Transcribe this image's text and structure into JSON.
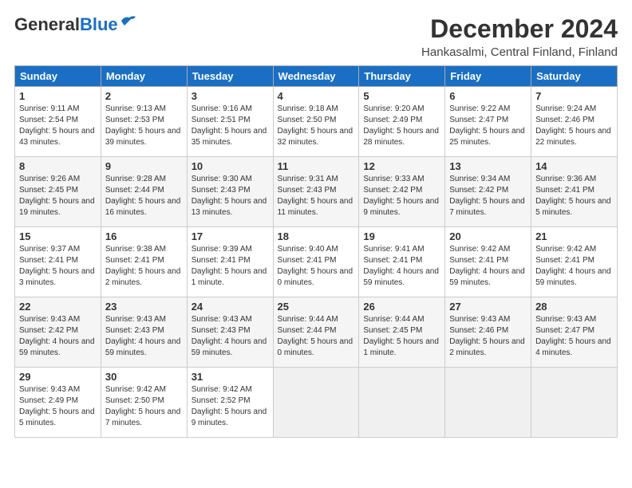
{
  "logo": {
    "line1": "General",
    "line2": "Blue"
  },
  "title": "December 2024",
  "location": "Hankasalmi, Central Finland, Finland",
  "headers": [
    "Sunday",
    "Monday",
    "Tuesday",
    "Wednesday",
    "Thursday",
    "Friday",
    "Saturday"
  ],
  "weeks": [
    [
      {
        "day": "1",
        "sunrise": "9:11 AM",
        "sunset": "2:54 PM",
        "daylight": "5 hours and 43 minutes."
      },
      {
        "day": "2",
        "sunrise": "9:13 AM",
        "sunset": "2:53 PM",
        "daylight": "5 hours and 39 minutes."
      },
      {
        "day": "3",
        "sunrise": "9:16 AM",
        "sunset": "2:51 PM",
        "daylight": "5 hours and 35 minutes."
      },
      {
        "day": "4",
        "sunrise": "9:18 AM",
        "sunset": "2:50 PM",
        "daylight": "5 hours and 32 minutes."
      },
      {
        "day": "5",
        "sunrise": "9:20 AM",
        "sunset": "2:49 PM",
        "daylight": "5 hours and 28 minutes."
      },
      {
        "day": "6",
        "sunrise": "9:22 AM",
        "sunset": "2:47 PM",
        "daylight": "5 hours and 25 minutes."
      },
      {
        "day": "7",
        "sunrise": "9:24 AM",
        "sunset": "2:46 PM",
        "daylight": "5 hours and 22 minutes."
      }
    ],
    [
      {
        "day": "8",
        "sunrise": "9:26 AM",
        "sunset": "2:45 PM",
        "daylight": "5 hours and 19 minutes."
      },
      {
        "day": "9",
        "sunrise": "9:28 AM",
        "sunset": "2:44 PM",
        "daylight": "5 hours and 16 minutes."
      },
      {
        "day": "10",
        "sunrise": "9:30 AM",
        "sunset": "2:43 PM",
        "daylight": "5 hours and 13 minutes."
      },
      {
        "day": "11",
        "sunrise": "9:31 AM",
        "sunset": "2:43 PM",
        "daylight": "5 hours and 11 minutes."
      },
      {
        "day": "12",
        "sunrise": "9:33 AM",
        "sunset": "2:42 PM",
        "daylight": "5 hours and 9 minutes."
      },
      {
        "day": "13",
        "sunrise": "9:34 AM",
        "sunset": "2:42 PM",
        "daylight": "5 hours and 7 minutes."
      },
      {
        "day": "14",
        "sunrise": "9:36 AM",
        "sunset": "2:41 PM",
        "daylight": "5 hours and 5 minutes."
      }
    ],
    [
      {
        "day": "15",
        "sunrise": "9:37 AM",
        "sunset": "2:41 PM",
        "daylight": "5 hours and 3 minutes."
      },
      {
        "day": "16",
        "sunrise": "9:38 AM",
        "sunset": "2:41 PM",
        "daylight": "5 hours and 2 minutes."
      },
      {
        "day": "17",
        "sunrise": "9:39 AM",
        "sunset": "2:41 PM",
        "daylight": "5 hours and 1 minute."
      },
      {
        "day": "18",
        "sunrise": "9:40 AM",
        "sunset": "2:41 PM",
        "daylight": "5 hours and 0 minutes."
      },
      {
        "day": "19",
        "sunrise": "9:41 AM",
        "sunset": "2:41 PM",
        "daylight": "4 hours and 59 minutes."
      },
      {
        "day": "20",
        "sunrise": "9:42 AM",
        "sunset": "2:41 PM",
        "daylight": "4 hours and 59 minutes."
      },
      {
        "day": "21",
        "sunrise": "9:42 AM",
        "sunset": "2:41 PM",
        "daylight": "4 hours and 59 minutes."
      }
    ],
    [
      {
        "day": "22",
        "sunrise": "9:43 AM",
        "sunset": "2:42 PM",
        "daylight": "4 hours and 59 minutes."
      },
      {
        "day": "23",
        "sunrise": "9:43 AM",
        "sunset": "2:43 PM",
        "daylight": "4 hours and 59 minutes."
      },
      {
        "day": "24",
        "sunrise": "9:43 AM",
        "sunset": "2:43 PM",
        "daylight": "4 hours and 59 minutes."
      },
      {
        "day": "25",
        "sunrise": "9:44 AM",
        "sunset": "2:44 PM",
        "daylight": "5 hours and 0 minutes."
      },
      {
        "day": "26",
        "sunrise": "9:44 AM",
        "sunset": "2:45 PM",
        "daylight": "5 hours and 1 minute."
      },
      {
        "day": "27",
        "sunrise": "9:43 AM",
        "sunset": "2:46 PM",
        "daylight": "5 hours and 2 minutes."
      },
      {
        "day": "28",
        "sunrise": "9:43 AM",
        "sunset": "2:47 PM",
        "daylight": "5 hours and 4 minutes."
      }
    ],
    [
      {
        "day": "29",
        "sunrise": "9:43 AM",
        "sunset": "2:49 PM",
        "daylight": "5 hours and 5 minutes."
      },
      {
        "day": "30",
        "sunrise": "9:42 AM",
        "sunset": "2:50 PM",
        "daylight": "5 hours and 7 minutes."
      },
      {
        "day": "31",
        "sunrise": "9:42 AM",
        "sunset": "2:52 PM",
        "daylight": "5 hours and 9 minutes."
      },
      null,
      null,
      null,
      null
    ]
  ],
  "labels": {
    "sunrise": "Sunrise:",
    "sunset": "Sunset:",
    "daylight": "Daylight:"
  }
}
